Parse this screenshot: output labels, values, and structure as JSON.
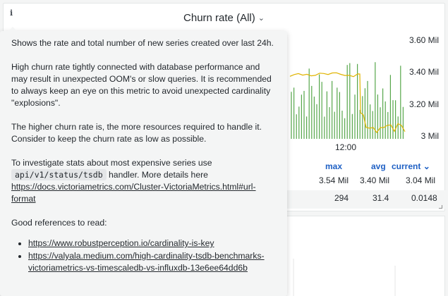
{
  "panel": {
    "title": "Churn rate (All)",
    "y_ticks": [
      "3.60 Mil",
      "3.40 Mil",
      "3.20 Mil",
      "3 Mil"
    ],
    "x_tick": "12:00",
    "legend": {
      "headers": {
        "max": "max",
        "avg": "avg",
        "current": "current"
      },
      "sort_arrow": "⌄",
      "rows": [
        {
          "max": "3.54 Mil",
          "avg": "3.40 Mil",
          "current": "3.04 Mil"
        },
        {
          "max": "294",
          "avg": "31.4",
          "current": "0.0148"
        }
      ]
    },
    "series_colors": {
      "orange": "#e0b400",
      "green": "#56a64b"
    }
  },
  "tooltip": {
    "p1": "Shows the rate and total number of new series created over last 24h.",
    "p2": "High churn rate tightly connected with database performance and may result in unexpected OOM's or slow queries. It is recommended to always keep an eye on this metric to avoid unexpected cardinality \"explosions\".",
    "p3": "The higher churn rate is, the more resources required to handle it. Consider to keep the churn rate as low as possible.",
    "p4_before": "To investigate stats about most expensive series use",
    "p4_code": "api/v1/status/tsdb",
    "p4_after": "handler. More details here",
    "p4_link": "https://docs.victoriametrics.com/Cluster-VictoriaMetrics.html#url-format",
    "p5": "Good references to read:",
    "links": [
      "https://www.robustperception.io/cardinality-is-key",
      "https://valyala.medium.com/high-cardinality-tsdb-benchmarks-victoriametrics-vs-timescaledb-vs-influxdb-13e6ee64dd6b"
    ]
  }
}
